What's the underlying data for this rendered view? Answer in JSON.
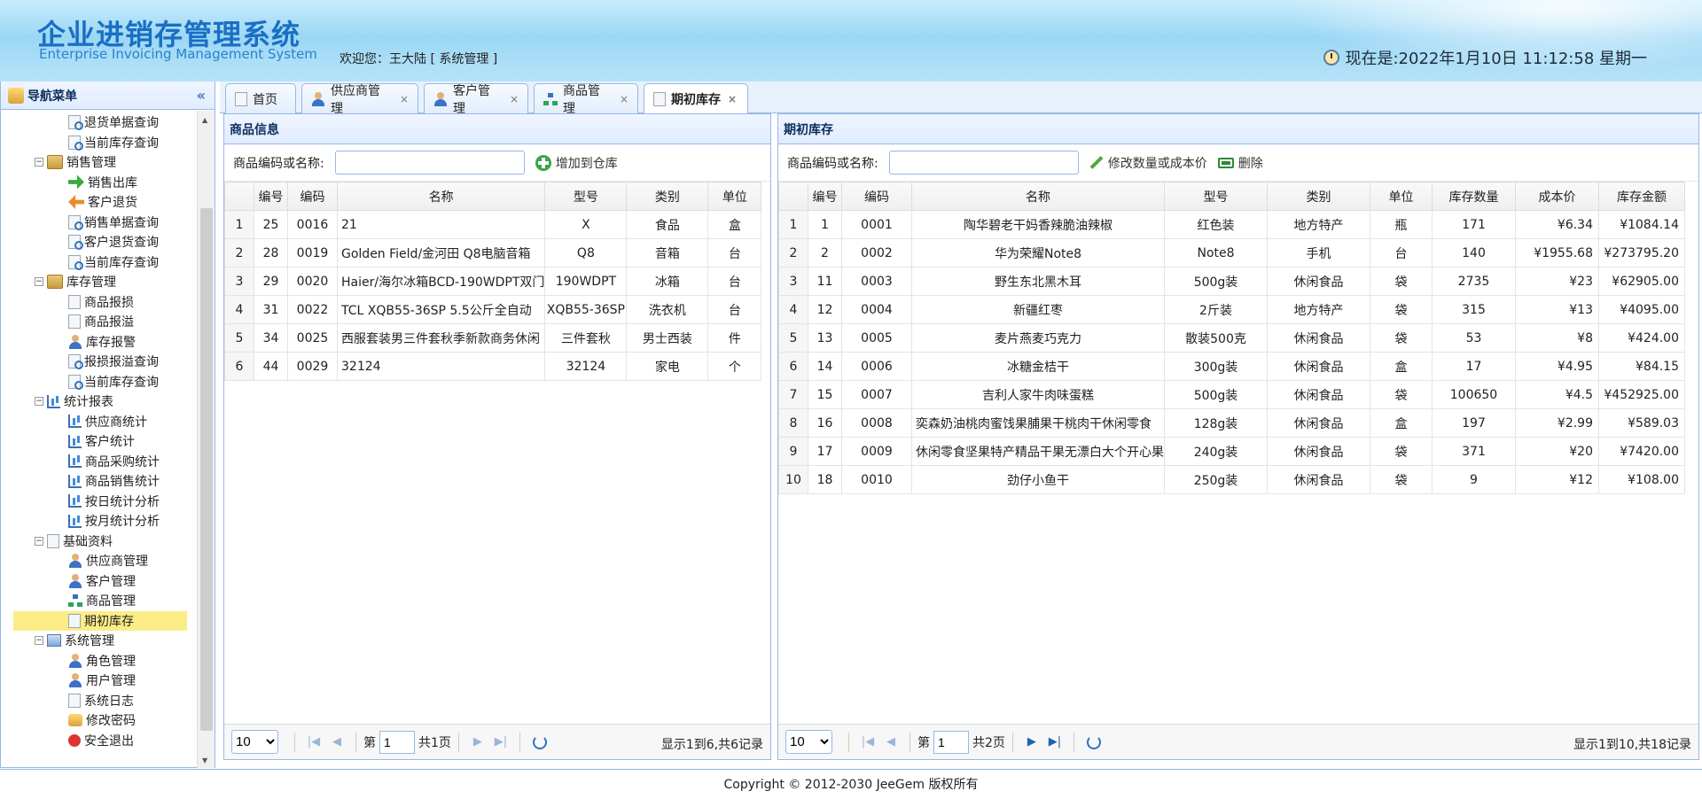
{
  "header": {
    "app_title": "企业进销存管理系统",
    "app_subtitle": "Enterprise Invoicing Management System",
    "welcome": "欢迎您：王大陆 [ 系统管理 ]",
    "clock": "现在是:2022年1月10日 11:12:58 星期一"
  },
  "nav": {
    "title": "导航菜单",
    "collapse": "«",
    "items": [
      {
        "label": "退货单据查询",
        "icon": "search-doc-icon"
      },
      {
        "label": "当前库存查询",
        "icon": "search-doc-icon"
      },
      {
        "label": "销售管理",
        "icon": "folder-icon",
        "group": true
      },
      {
        "label": "销售出库",
        "icon": "green-arrow-icon"
      },
      {
        "label": "客户退货",
        "icon": "orange-arrow-icon"
      },
      {
        "label": "销售单据查询",
        "icon": "search-doc-icon"
      },
      {
        "label": "客户退货查询",
        "icon": "search-doc-icon"
      },
      {
        "label": "当前库存查询",
        "icon": "search-doc-icon"
      },
      {
        "label": "库存管理",
        "icon": "folder-icon",
        "group": true
      },
      {
        "label": "商品报损",
        "icon": "doc-icon"
      },
      {
        "label": "商品报溢",
        "icon": "doc-icon"
      },
      {
        "label": "库存报警",
        "icon": "user-icon"
      },
      {
        "label": "报损报溢查询",
        "icon": "search-doc-icon"
      },
      {
        "label": "当前库存查询",
        "icon": "search-doc-icon"
      },
      {
        "label": "统计报表",
        "icon": "chart-icon",
        "group": true
      },
      {
        "label": "供应商统计",
        "icon": "chart-icon"
      },
      {
        "label": "客户统计",
        "icon": "chart-icon"
      },
      {
        "label": "商品采购统计",
        "icon": "chart-icon"
      },
      {
        "label": "商品销售统计",
        "icon": "chart-icon"
      },
      {
        "label": "按日统计分析",
        "icon": "chart-icon"
      },
      {
        "label": "按月统计分析",
        "icon": "chart-icon"
      },
      {
        "label": "基础资料",
        "icon": "doc-icon",
        "group": true
      },
      {
        "label": "供应商管理",
        "icon": "user-icon"
      },
      {
        "label": "客户管理",
        "icon": "user-icon"
      },
      {
        "label": "商品管理",
        "icon": "tree-icon"
      },
      {
        "label": "期初库存",
        "icon": "doc-icon",
        "selected": true
      },
      {
        "label": "系统管理",
        "icon": "pc-icon",
        "group": true
      },
      {
        "label": "角色管理",
        "icon": "user-icon"
      },
      {
        "label": "用户管理",
        "icon": "user-icon"
      },
      {
        "label": "系统日志",
        "icon": "doc-icon"
      },
      {
        "label": "修改密码",
        "icon": "key-icon"
      },
      {
        "label": "安全退出",
        "icon": "exit-icon"
      }
    ]
  },
  "tabs": [
    {
      "label": "首页",
      "closable": false
    },
    {
      "label": "供应商管理",
      "closable": true
    },
    {
      "label": "客户管理",
      "closable": true
    },
    {
      "label": "商品管理",
      "closable": true
    },
    {
      "label": "期初库存",
      "closable": true,
      "active": true
    }
  ],
  "left_panel": {
    "title": "商品信息",
    "search_label": "商品编码或名称:",
    "search_value": "",
    "add_button": "增加到仓库",
    "columns": [
      "",
      "编号",
      "编码",
      "名称",
      "型号",
      "类别",
      "单位"
    ],
    "rows": [
      [
        "1",
        "25",
        "0016",
        "21",
        "X",
        "食品",
        "盒"
      ],
      [
        "2",
        "28",
        "0019",
        "Golden Field/金河田 Q8电脑音箱",
        "Q8",
        "音箱",
        "台"
      ],
      [
        "3",
        "29",
        "0020",
        "Haier/海尔冰箱BCD-190WDPT双门",
        "190WDPT",
        "冰箱",
        "台"
      ],
      [
        "4",
        "31",
        "0022",
        "TCL XQB55-36SP 5.5公斤全自动",
        "XQB55-36SP",
        "洗衣机",
        "台"
      ],
      [
        "5",
        "34",
        "0025",
        "西服套装男三件套秋季新款商务休闲",
        "三件套秋",
        "男士西装",
        "件"
      ],
      [
        "6",
        "44",
        "0029",
        "32124",
        "32124",
        "家电",
        "个"
      ]
    ],
    "pager": {
      "page_size": "10",
      "page_label_pre": "第",
      "page": "1",
      "page_label_post": "共1页",
      "info": "显示1到6,共6记录"
    }
  },
  "right_panel": {
    "title": "期初库存",
    "search_label": "商品编码或名称:",
    "search_value": "",
    "edit_button": "修改数量或成本价",
    "delete_button": "删除",
    "columns": [
      "",
      "编号",
      "编码",
      "名称",
      "型号",
      "类别",
      "单位",
      "库存数量",
      "成本价",
      "库存金额"
    ],
    "rows": [
      [
        "1",
        "1",
        "0001",
        "陶华碧老干妈香辣脆油辣椒",
        "红色装",
        "地方特产",
        "瓶",
        "171",
        "¥6.34",
        "¥1084.14"
      ],
      [
        "2",
        "2",
        "0002",
        "华为荣耀Note8",
        "Note8",
        "手机",
        "台",
        "140",
        "¥1955.68",
        "¥273795.20"
      ],
      [
        "3",
        "11",
        "0003",
        "野生东北黑木耳",
        "500g装",
        "休闲食品",
        "袋",
        "2735",
        "¥23",
        "¥62905.00"
      ],
      [
        "4",
        "12",
        "0004",
        "新疆红枣",
        "2斤装",
        "地方特产",
        "袋",
        "315",
        "¥13",
        "¥4095.00"
      ],
      [
        "5",
        "13",
        "0005",
        "麦片燕麦巧克力",
        "散装500克",
        "休闲食品",
        "袋",
        "53",
        "¥8",
        "¥424.00"
      ],
      [
        "6",
        "14",
        "0006",
        "冰糖金桔干",
        "300g装",
        "休闲食品",
        "盒",
        "17",
        "¥4.95",
        "¥84.15"
      ],
      [
        "7",
        "15",
        "0007",
        "吉利人家牛肉味蛋糕",
        "500g装",
        "休闲食品",
        "袋",
        "100650",
        "¥4.5",
        "¥452925.00"
      ],
      [
        "8",
        "16",
        "0008",
        "奕森奶油桃肉蜜饯果脯果干桃肉干休闲零食",
        "128g装",
        "休闲食品",
        "盒",
        "197",
        "¥2.99",
        "¥589.03"
      ],
      [
        "9",
        "17",
        "0009",
        "休闲零食坚果特产精品干果无漂白大个开心果",
        "240g装",
        "休闲食品",
        "袋",
        "371",
        "¥20",
        "¥7420.00"
      ],
      [
        "10",
        "18",
        "0010",
        "劲仔小鱼干",
        "250g装",
        "休闲食品",
        "袋",
        "9",
        "¥12",
        "¥108.00"
      ]
    ],
    "pager": {
      "page_size": "10",
      "page_label_pre": "第",
      "page": "1",
      "page_label_post": "共2页",
      "info": "显示1到10,共18记录"
    }
  },
  "footer": {
    "text": "Copyright © 2012-2030 JeeGem 版权所有"
  }
}
